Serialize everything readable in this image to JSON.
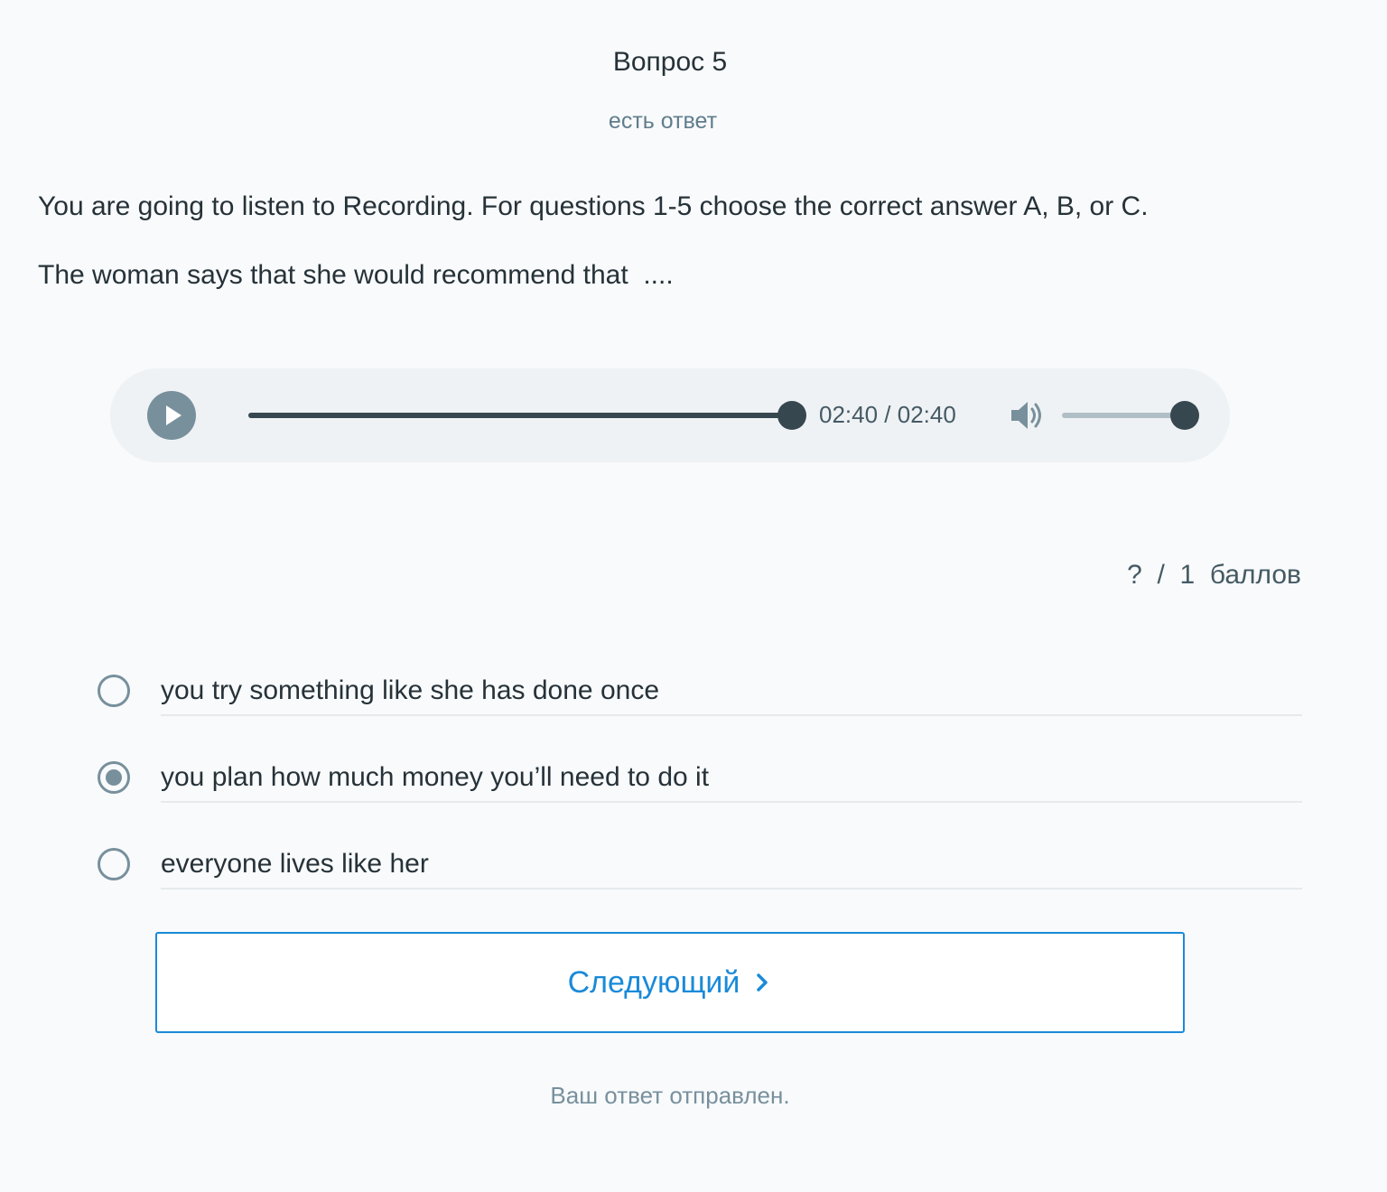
{
  "question": {
    "title": "Вопрос 5",
    "status": "есть ответ",
    "instructions": "You are going to listen to Recording. For questions 1-5 choose the correct answer A, B, or C.",
    "prompt": "The woman says that she would recommend that  ...."
  },
  "player": {
    "play_icon": "play-icon",
    "time": "02:40 / 02:40",
    "progress_fraction": 1.0,
    "volume_icon": "volume-icon",
    "volume_fraction": 1.0
  },
  "score": "?  /  1  баллов",
  "options": [
    {
      "label": "you try something like she has done once",
      "checked": false
    },
    {
      "label": "you plan how much money you’ll need to do it",
      "checked": true
    },
    {
      "label": "everyone lives like her",
      "checked": false
    }
  ],
  "next_button": {
    "label": "Следующий",
    "icon": "chevron-right-icon"
  },
  "submitted_message": "Ваш ответ отправлен.",
  "colors": {
    "background": "#f8fafc",
    "accent": "#1a8ad8",
    "player_bg": "#eff2f4",
    "radio": "#78909c"
  }
}
